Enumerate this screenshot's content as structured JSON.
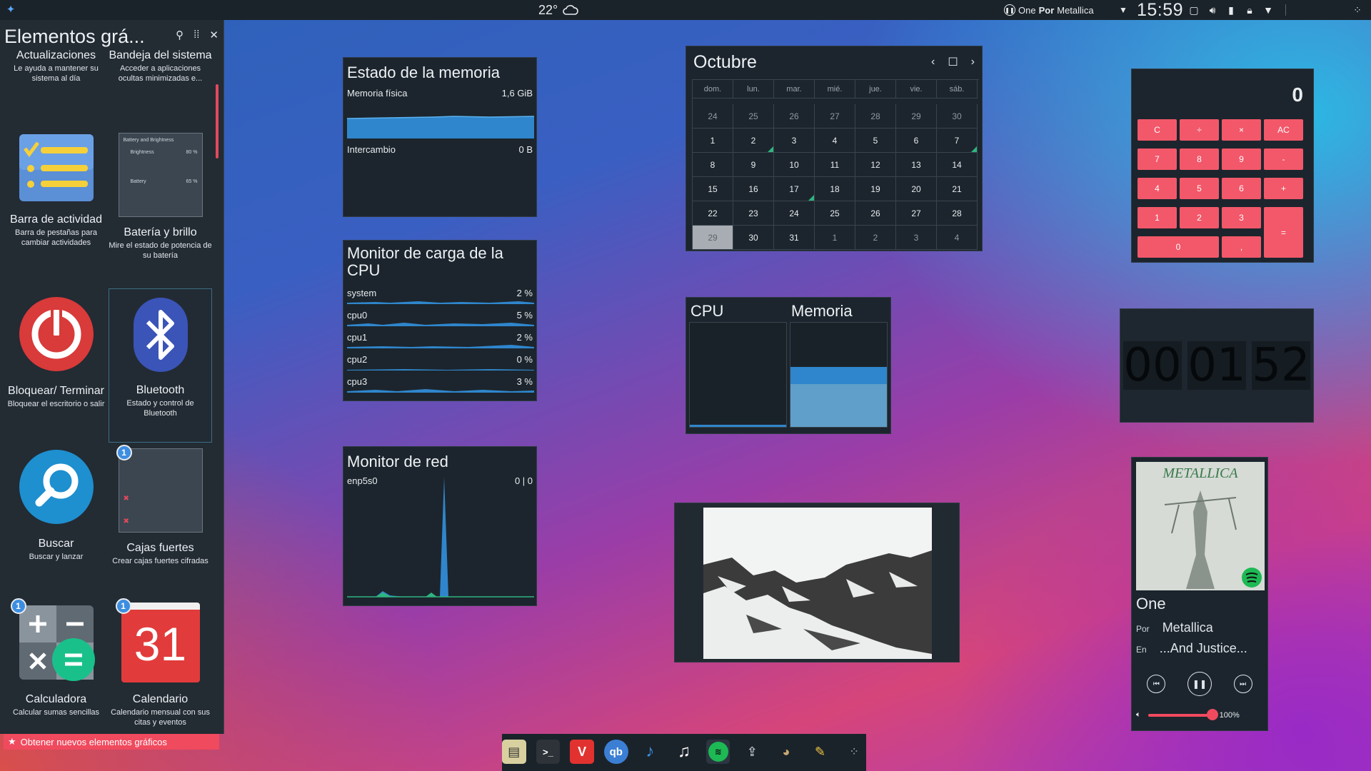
{
  "topbar": {
    "temperature": "22°",
    "media_title": "One",
    "media_by": "Por",
    "media_artist": "Metallica",
    "clock": "15:59"
  },
  "explorer": {
    "title": "Elementos grá...",
    "footer": "Obtener nuevos elementos gráficos",
    "items": [
      {
        "name": "Actualizaciones",
        "desc": "Le ayuda a mantener su sistema al día",
        "icon": "updates-icon"
      },
      {
        "name": "Bandeja del sistema",
        "desc": "Acceder a aplicaciones ocultas minimizadas e...",
        "icon": "system-tray-icon"
      },
      {
        "name": "Barra de actividad",
        "desc": "Barra de pestañas para cambiar actividades",
        "icon": "activity-bar-icon"
      },
      {
        "name": "Batería y brillo",
        "desc": "Mire el estado de potencia de su batería",
        "icon": "battery-brightness-icon",
        "preview_title": "Battery and Brightness",
        "preview_row1": "Brightness",
        "preview_val1": "80 %",
        "preview_row2": "Battery",
        "preview_val2": "65 %"
      },
      {
        "name": "Bloquear/ Terminar",
        "desc": "Bloquear el escritorio o salir",
        "icon": "power-icon"
      },
      {
        "name": "Bluetooth",
        "desc": "Estado y control de Bluetooth",
        "icon": "bluetooth-icon"
      },
      {
        "name": "Buscar",
        "desc": "Buscar y lanzar",
        "icon": "search-icon"
      },
      {
        "name": "Cajas fuertes",
        "desc": "Crear cajas fuertes cifradas",
        "icon": "vaults-icon",
        "badge": "1"
      },
      {
        "name": "Calculadora",
        "desc": "Calcular sumas sencillas",
        "icon": "calculator-icon",
        "badge": "1"
      },
      {
        "name": "Calendario",
        "desc": "Calendario mensual con sus citas y eventos",
        "icon": "calendar-icon",
        "badge": "1",
        "icon_text": "31"
      }
    ]
  },
  "memory": {
    "title": "Estado de la memoria",
    "physical_label": "Memoria física",
    "physical_value": "1,6 GiB",
    "swap_label": "Intercambio",
    "swap_value": "0 B"
  },
  "cpu_load": {
    "title": "Monitor de carga de la CPU",
    "rows": [
      {
        "label": "system",
        "value": "2 %"
      },
      {
        "label": "cpu0",
        "value": "5 %"
      },
      {
        "label": "cpu1",
        "value": "2 %"
      },
      {
        "label": "cpu2",
        "value": "0 %"
      },
      {
        "label": "cpu3",
        "value": "3 %"
      }
    ]
  },
  "network": {
    "title": "Monitor de red",
    "interface": "enp5s0",
    "value": "0 | 0"
  },
  "calendar": {
    "month": "Octubre",
    "weekdays": [
      "dom.",
      "lun.",
      "mar.",
      "mié.",
      "jue.",
      "vie.",
      "sáb."
    ],
    "days": [
      "24",
      "25",
      "26",
      "27",
      "28",
      "29",
      "30",
      "1",
      "2",
      "3",
      "4",
      "5",
      "6",
      "7",
      "8",
      "9",
      "10",
      "11",
      "12",
      "13",
      "14",
      "15",
      "16",
      "17",
      "18",
      "19",
      "20",
      "21",
      "22",
      "23",
      "24",
      "25",
      "26",
      "27",
      "28",
      "29",
      "30",
      "31",
      "1",
      "2",
      "3",
      "4"
    ],
    "today": "29"
  },
  "calculator": {
    "display": "0",
    "keys": [
      "C",
      "÷",
      "×",
      "AC",
      "7",
      "8",
      "9",
      "-",
      "4",
      "5",
      "6",
      "+",
      "1",
      "2",
      "3",
      "=",
      "0",
      ","
    ]
  },
  "timer": {
    "hours": "00",
    "minutes": "01",
    "seconds": "52"
  },
  "system_monitor": {
    "cpu_label": "CPU",
    "memory_label": "Memoria"
  },
  "player": {
    "track": "One",
    "by_label": "Por",
    "artist": "Metallica",
    "album_label": "En",
    "album": "...And Justice...",
    "volume": "100%",
    "album_art_text": "METALLICA"
  },
  "colors": {
    "accent": "#f04a5e",
    "panel_bg": "#1b232a",
    "widget_bg": "#1c252d",
    "graph_blue": "#3d9be0",
    "graph_green": "#2fb47f"
  }
}
